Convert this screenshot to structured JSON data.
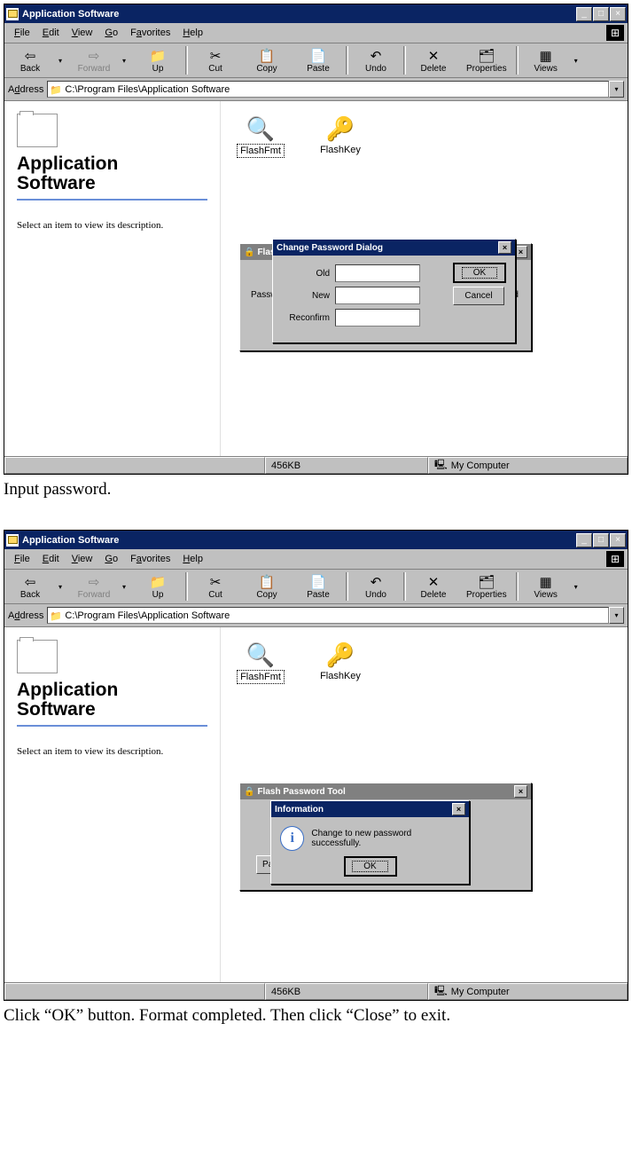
{
  "window": {
    "title": "Application Software",
    "btn_min": "_",
    "btn_max": "□",
    "btn_close": "×"
  },
  "menu": {
    "file": "File",
    "edit": "Edit",
    "view": "View",
    "go": "Go",
    "favorites": "Favorites",
    "help": "Help"
  },
  "toolbar": {
    "back": "Back",
    "forward": "Forward",
    "up": "Up",
    "cut": "Cut",
    "copy": "Copy",
    "paste": "Paste",
    "undo": "Undo",
    "delete": "Delete",
    "properties": "Properties",
    "views": "Views"
  },
  "address": {
    "label": "Address",
    "path": "C:\\Program Files\\Application Software"
  },
  "leftpane": {
    "title1": "Application",
    "title2": "Software",
    "desc": "Select an item to view its description."
  },
  "files": {
    "flashfmt": "FlashFmt",
    "flashkey": "FlashKey"
  },
  "dialog1": {
    "bg_title": "Flash F",
    "bg_label": "Passw",
    "bg_right": "ssword",
    "title": "Change Password Dialog",
    "old": "Old",
    "new": "New",
    "reconfirm": "Reconfirm",
    "ok": "OK",
    "cancel": "Cancel"
  },
  "status": {
    "size": "456KB",
    "location": "My Computer"
  },
  "caption1": "Input password.",
  "dialog2": {
    "bg_title": "Flash Password Tool",
    "password": "Password",
    "info_title": "Information",
    "info_msg": "Change to new password successfully.",
    "ok": "OK"
  },
  "caption2": "Click “OK” button. Format completed. Then click “Close” to exit."
}
